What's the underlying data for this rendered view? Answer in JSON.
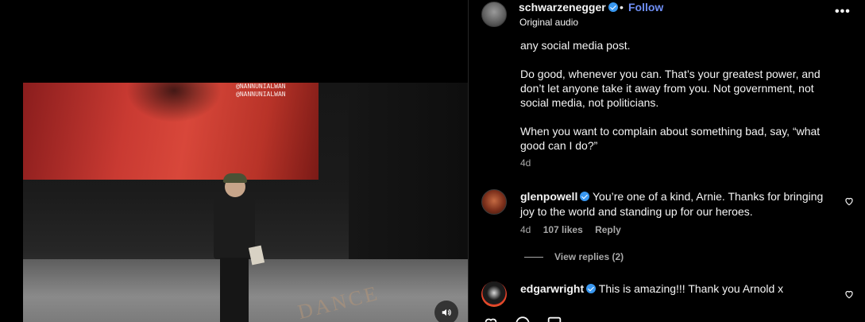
{
  "video": {
    "screen_handles": [
      "@NANNUNIALWAN",
      "@NANNUNIALWAN"
    ],
    "stage_logo": "DANCE"
  },
  "post": {
    "owner": "schwarzenegger",
    "follow_label": "Follow",
    "separator": "•",
    "audio": "Original audio",
    "more_icon": "more-horizontal-icon",
    "more_glyph": "•••",
    "caption_paragraphs": [
      "any social media post.",
      "Do good, whenever you can. That’s your greatest power, and don’t let anyone take it away from you. Not government, not social media, not politicians.",
      "When you want to complain about something bad, say, “what good can I do?”"
    ],
    "time": "4d"
  },
  "comments": [
    {
      "username": "glenpowell",
      "text": "You’re one of a kind, Arnie. Thanks for bringing joy to the world and standing up for our heroes.",
      "time": "4d",
      "likes": "107 likes",
      "reply_label": "Reply",
      "view_replies": "View replies (2)"
    },
    {
      "username": "edgarwright",
      "text": "This is amazing!!! Thank you Arnold x"
    }
  ],
  "colors": {
    "accent_follow": "#6f8ff5",
    "verified": "#3897f0",
    "muted_text": "#a8a8a8",
    "background": "#000000"
  }
}
